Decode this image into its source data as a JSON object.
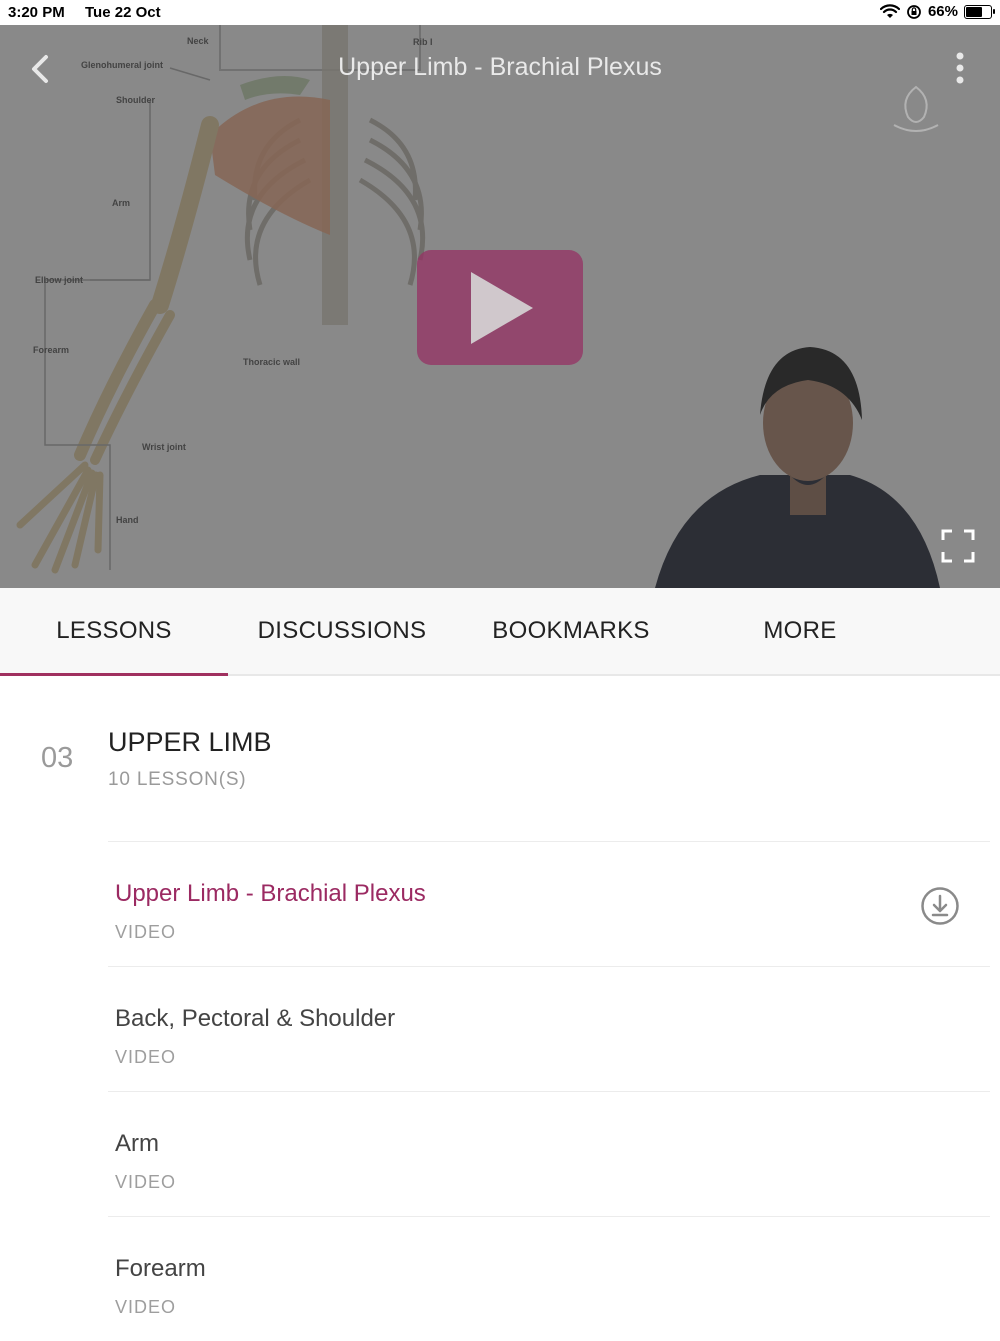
{
  "status_bar": {
    "time": "3:20 PM",
    "date": "Tue 22 Oct",
    "battery_percent": "66%",
    "battery_level": 0.66,
    "icons": [
      "wifi-icon",
      "orientation-lock-icon",
      "battery-icon"
    ]
  },
  "player": {
    "title": "Upper Limb - Brachial Plexus",
    "diagram_labels": [
      "Neck",
      "Rib I",
      "Glenohumeral joint",
      "Shoulder",
      "Arm",
      "Elbow joint",
      "Forearm",
      "Thoracic wall",
      "Wrist joint",
      "Hand"
    ],
    "icons": [
      "back-icon",
      "more-vertical-icon",
      "play-icon",
      "fullscreen-icon"
    ]
  },
  "tabs": [
    {
      "label": "LESSONS",
      "active": true
    },
    {
      "label": "DISCUSSIONS",
      "active": false
    },
    {
      "label": "BOOKMARKS",
      "active": false
    },
    {
      "label": "MORE",
      "active": false
    }
  ],
  "section": {
    "number": "03",
    "title": "UPPER LIMB",
    "count": "10 LESSON(S)"
  },
  "lessons": [
    {
      "title": "Upper Limb - Brachial Plexus",
      "type": "VIDEO",
      "active": true
    },
    {
      "title": "Back, Pectoral & Shoulder",
      "type": "VIDEO",
      "active": false
    },
    {
      "title": "Arm",
      "type": "VIDEO",
      "active": false
    },
    {
      "title": "Forearm",
      "type": "VIDEO",
      "active": false
    }
  ],
  "colors": {
    "accent": "#9b2a62",
    "play_button": "#963264"
  }
}
